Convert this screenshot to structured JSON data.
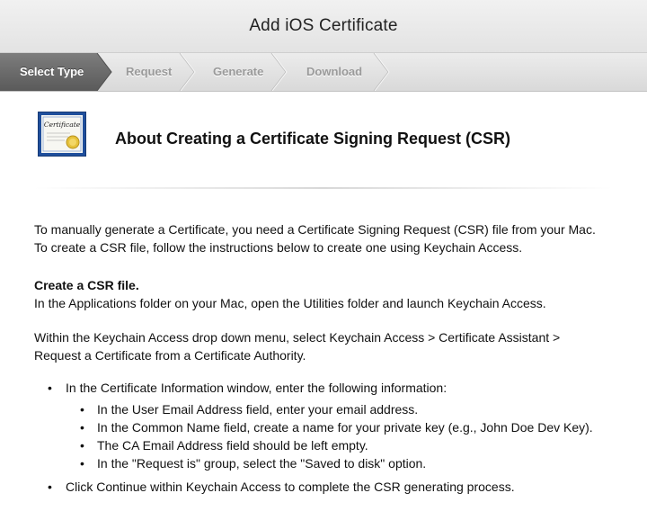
{
  "window": {
    "title": "Add iOS Certificate"
  },
  "steps": [
    {
      "label": "Select Type",
      "active": true
    },
    {
      "label": "Request",
      "active": false
    },
    {
      "label": "Generate",
      "active": false
    },
    {
      "label": "Download",
      "active": false
    }
  ],
  "header": {
    "icon": "certificate-icon",
    "certificate_icon_text": "Certificate",
    "heading": "About Creating a Certificate Signing Request (CSR)"
  },
  "content": {
    "intro": "To manually generate a Certificate, you need a Certificate Signing Request (CSR) file from your Mac. To create a CSR file, follow the instructions below to create one using Keychain Access.",
    "section_heading": "Create a CSR file.",
    "section_text": "In the Applications folder on your Mac, open the Utilities folder and launch Keychain Access.",
    "menu_instructions": "Within the Keychain Access drop down menu, select Keychain Access > Certificate Assistant > Request a Certificate from a Certificate Authority.",
    "bullets": [
      {
        "text": "In the Certificate Information window, enter the following information:",
        "sub": [
          "In the User Email Address field, enter your email address.",
          "In the Common Name field, create a name for your private key (e.g., John Doe Dev Key).",
          "The CA Email Address field should be left empty.",
          "In the \"Request is\" group, select the \"Saved to disk\" option."
        ]
      },
      {
        "text": "Click Continue within Keychain Access to complete the CSR generating process."
      }
    ],
    "bullet_glyph": "•"
  },
  "colors": {
    "active_step": "#6a6a6a",
    "inactive_step_text": "#9a9a9a",
    "divider": "#dddddd"
  }
}
